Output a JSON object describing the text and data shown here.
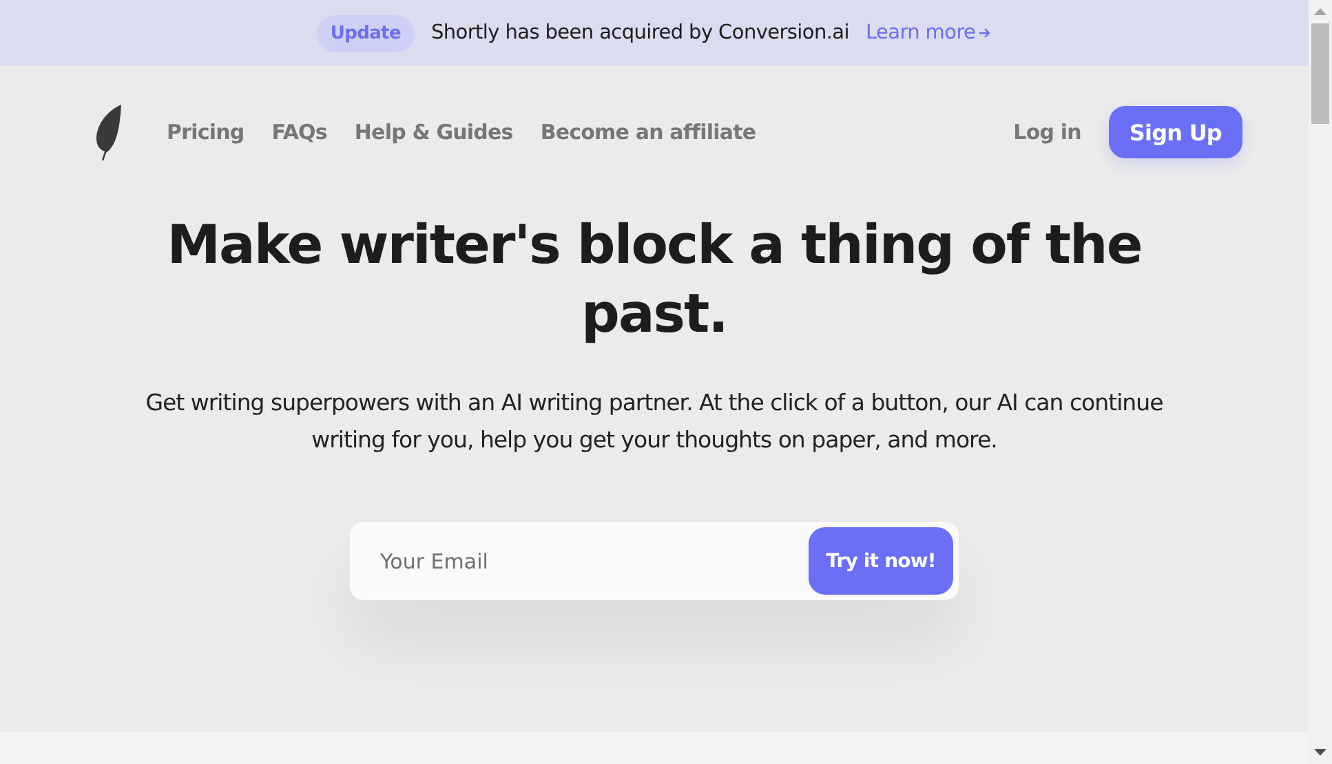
{
  "announcement": {
    "badge": "Update",
    "message": "Shortly has been acquired by Conversion.ai",
    "link": "Learn more"
  },
  "nav": {
    "links": [
      "Pricing",
      "FAQs",
      "Help & Guides",
      "Become an affiliate"
    ],
    "login": "Log in",
    "signup": "Sign Up"
  },
  "hero": {
    "title": "Make writer's block a thing of the past.",
    "subtitle": "Get writing superpowers with an AI writing partner. At the click of a button, our AI can continue writing for you, help you get your thoughts on paper, and more."
  },
  "signup_form": {
    "placeholder": "Your Email",
    "button": "Try it now!"
  }
}
